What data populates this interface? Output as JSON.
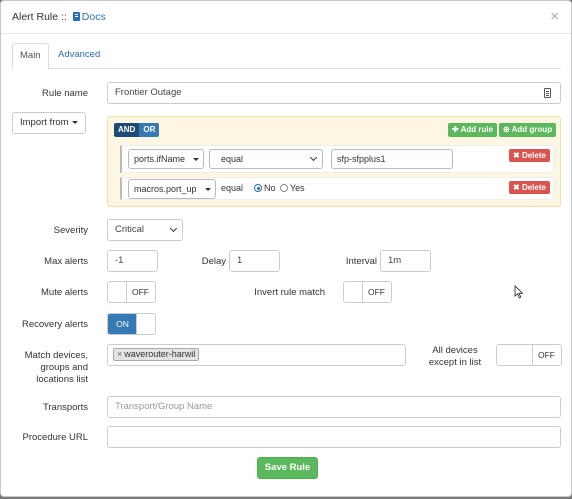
{
  "header": {
    "title": "Alert Rule ::",
    "docs_label": "Docs",
    "close_glyph": "×"
  },
  "tabs": [
    {
      "label": "Main",
      "active": true
    },
    {
      "label": "Advanced",
      "active": false
    }
  ],
  "rule_name": {
    "label": "Rule name",
    "value": "Frontier Outage"
  },
  "import_from": {
    "label": "Import from"
  },
  "query_builder": {
    "and_label": "AND",
    "or_label": "OR",
    "add_rule_label": "Add rule",
    "add_group_label": "Add group",
    "rules": [
      {
        "field": "ports.ifName",
        "operator": "equal",
        "value": "sfp-sfpplus1",
        "delete_label": "Delete"
      },
      {
        "field": "macros.port_up",
        "operator": "equal",
        "radio_no": "No",
        "radio_yes": "Yes",
        "selected": "No",
        "delete_label": "Delete"
      }
    ]
  },
  "severity": {
    "label": "Severity",
    "value": "Critical"
  },
  "max_alerts": {
    "label": "Max alerts",
    "value": "-1"
  },
  "delay": {
    "label": "Delay",
    "value": "1"
  },
  "interval": {
    "label": "Interval",
    "value": "1m"
  },
  "mute_alerts": {
    "label": "Mute alerts",
    "state": "OFF"
  },
  "invert_rule_match": {
    "label": "Invert rule match",
    "state": "OFF"
  },
  "recovery_alerts": {
    "label": "Recovery alerts",
    "state": "ON"
  },
  "match_devices": {
    "label_line1": "Match devices,",
    "label_line2": "groups and",
    "label_line3": "locations list",
    "tags": [
      "waverouter-harwil"
    ]
  },
  "all_devices_except": {
    "label_line1": "All devices",
    "label_line2": "except in list",
    "state": "OFF"
  },
  "transports": {
    "label": "Transports",
    "placeholder": "Transport/Group Name"
  },
  "procedure_url": {
    "label": "Procedure URL",
    "value": ""
  },
  "save_label": "Save Rule",
  "colors": {
    "primary": "#337ab7",
    "success": "#5cb85c",
    "danger": "#d9534f",
    "link": "#2a6fb8",
    "group_bg": "#fcf6e3"
  }
}
